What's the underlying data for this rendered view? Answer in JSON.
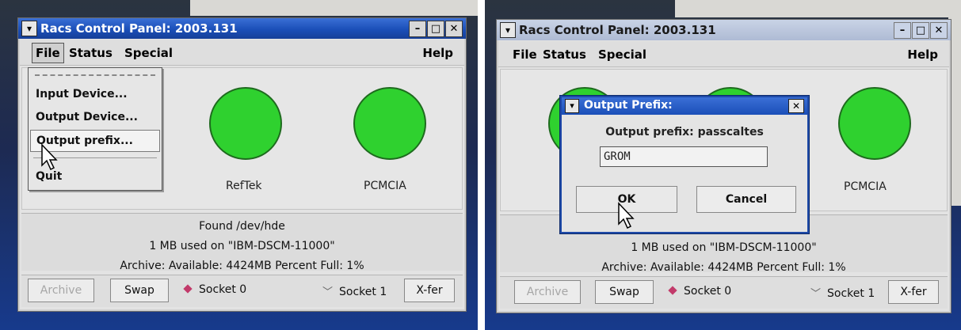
{
  "window": {
    "title": "Racs Control Panel: 2003.131",
    "menu_file": "File",
    "menu_status": "Status",
    "menu_special": "Special",
    "menu_help": "Help"
  },
  "leds": {
    "reftek_label": "RefTek",
    "pcmcia_label": "PCMCIA",
    "color": "#2fd12f"
  },
  "status": {
    "line1": "Found  /dev/hde",
    "line2": "1 MB used on \"IBM-DSCM-11000\"",
    "line3": "Archive:  Available: 4424MB Percent Full: 1%"
  },
  "toolbar": {
    "archive": "Archive",
    "swap": "Swap",
    "socket0": "Socket 0",
    "socket1": "Socket 1",
    "xfer": "X-fer"
  },
  "file_menu": {
    "input_device": "Input Device...",
    "output_device": "Output Device...",
    "output_prefix": "Output prefix...",
    "quit": "Quit"
  },
  "dialog": {
    "title": "Output Prefix:",
    "prompt": "Output prefix: passcaltes",
    "value": "GROM",
    "ok": "OK",
    "cancel": "Cancel"
  },
  "colors": {
    "titlebar": "#1b4fb8",
    "socket_diamond": "#c23a6a"
  },
  "icons": [
    "window-menu-icon",
    "minimize-icon",
    "maximize-icon",
    "close-icon",
    "mouse-pointer-icon",
    "socket-diamond-icon",
    "chevron-down-icon"
  ]
}
